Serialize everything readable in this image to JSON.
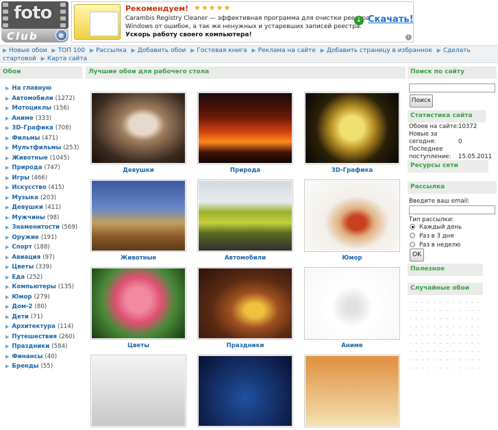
{
  "header": {
    "logo_text": "foto",
    "logo_sub": "Club",
    "ad": {
      "headline": "Рекомендуем!",
      "stars": "★★★★★",
      "line1": "Carambis Registry Cleaner — эффективная программа для очистки реестра",
      "line2": "Windows от ошибок, а так же ненужных и устаревших записей реестра.",
      "line3": "Ускорь работу своего компьютера!",
      "download_label": "Скачать!"
    }
  },
  "nav": {
    "items": [
      {
        "label": "Новые обои"
      },
      {
        "label": "ТОП 100"
      },
      {
        "label": "Рассылка"
      },
      {
        "label": "Добавить обои"
      },
      {
        "label": "Гостевая книга"
      },
      {
        "label": "Реклама на сайте"
      },
      {
        "label": "Добавить страницу в избранное"
      },
      {
        "label": "Сделать"
      },
      {
        "label": "стартовой"
      },
      {
        "label": "Карта сайта"
      }
    ]
  },
  "left": {
    "title": "Обои",
    "categories": [
      {
        "label": "На главную",
        "count": ""
      },
      {
        "label": "Автомобили",
        "count": "(1272)"
      },
      {
        "label": "Мотоциклы",
        "count": "(156)"
      },
      {
        "label": "Аниме",
        "count": "(333)"
      },
      {
        "label": "3D-Графика",
        "count": "(708)"
      },
      {
        "label": "Фильмы",
        "count": "(471)"
      },
      {
        "label": "Мультфильмы",
        "count": "(253)"
      },
      {
        "label": "Животные",
        "count": "(1045)"
      },
      {
        "label": "Природа",
        "count": "(747)"
      },
      {
        "label": "Игры",
        "count": "(466)"
      },
      {
        "label": "Искусство",
        "count": "(415)"
      },
      {
        "label": "Музыка",
        "count": "(203)"
      },
      {
        "label": "Девушки",
        "count": "(411)"
      },
      {
        "label": "Мужчины",
        "count": "(98)"
      },
      {
        "label": "Знаменитости",
        "count": "(569)"
      },
      {
        "label": "Оружие",
        "count": "(191)"
      },
      {
        "label": "Спорт",
        "count": "(188)"
      },
      {
        "label": "Авиация",
        "count": "(97)"
      },
      {
        "label": "Цветы",
        "count": "(339)"
      },
      {
        "label": "Еда",
        "count": "(252)"
      },
      {
        "label": "Компьютеры",
        "count": "(135)"
      },
      {
        "label": "Юмор",
        "count": "(279)"
      },
      {
        "label": "Дом-2",
        "count": "(80)"
      },
      {
        "label": "Дети",
        "count": "(71)"
      },
      {
        "label": "Архитектура",
        "count": "(114)"
      },
      {
        "label": "Путешествия",
        "count": "(260)"
      },
      {
        "label": "Праздники",
        "count": "(584)"
      },
      {
        "label": "Финансы",
        "count": "(40)"
      },
      {
        "label": "Бренды",
        "count": "(55)"
      }
    ]
  },
  "main": {
    "title": "Лучшие обои для рабочего стола",
    "thumbs": [
      {
        "caption": "Девушки"
      },
      {
        "caption": "Природа"
      },
      {
        "caption": "3D-Графика"
      },
      {
        "caption": "Животные"
      },
      {
        "caption": "Автомобили"
      },
      {
        "caption": "Юмор"
      },
      {
        "caption": "Цветы"
      },
      {
        "caption": "Праздники"
      },
      {
        "caption": "Аниме"
      },
      {
        "caption": ""
      },
      {
        "caption": ""
      },
      {
        "caption": ""
      }
    ]
  },
  "right": {
    "search_title": "Поиск по сайту",
    "search_button": "Поиск",
    "stats_title": "Статистика сайта",
    "stats": [
      {
        "k": "Обоев на сайте:",
        "v": "10372"
      },
      {
        "k": "Новые за",
        "v": ""
      },
      {
        "k": "сегодня:",
        "v": "0"
      },
      {
        "k": "Последнее",
        "v": ""
      },
      {
        "k": "поступление:",
        "v": "15.05.2011"
      }
    ],
    "resources_title": "Ресурсы сети",
    "newsletter_title": "Рассылка",
    "email_label": "Введите ваш email:",
    "type_label": "Тип рассылки:",
    "options": [
      {
        "label": "Каждый день",
        "checked": true
      },
      {
        "label": "Раз в 3 дня",
        "checked": false
      },
      {
        "label": "Раз в неделю",
        "checked": false
      }
    ],
    "ok_button": "OK",
    "useful_title": "Полезное",
    "random_title": "Случайные обои"
  }
}
